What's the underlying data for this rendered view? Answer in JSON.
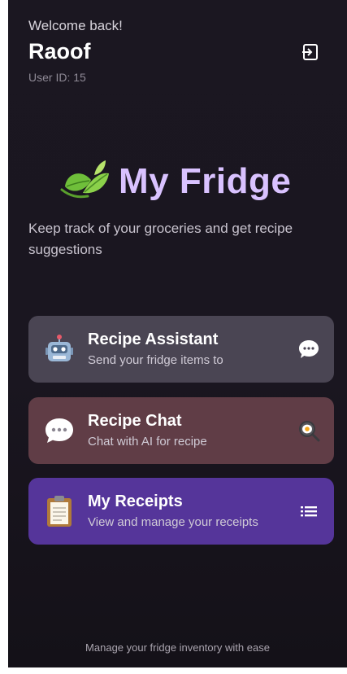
{
  "header": {
    "welcome": "Welcome back!",
    "username": "Raoof",
    "user_id": "User ID: 15",
    "logout_icon": "logout-icon"
  },
  "hero": {
    "title": "My Fridge",
    "icon": "leaf-icon",
    "tagline": "Keep track of your groceries and get recipe suggestions"
  },
  "cards": [
    {
      "title": "Recipe Assistant",
      "subtitle": "Send your fridge items to",
      "icon": "robot-icon",
      "trailing_icon": "speech-bubble-icon",
      "color": "#4a4553"
    },
    {
      "title": "Recipe Chat",
      "subtitle": "Chat with AI for recipe",
      "icon": "speech-bubble-icon",
      "trailing_icon": "frying-pan-icon",
      "color": "#603d46"
    },
    {
      "title": "My Receipts",
      "subtitle": "View and manage your receipts",
      "icon": "clipboard-icon",
      "trailing_icon": "list-icon",
      "color": "#55359a"
    }
  ],
  "footer": {
    "text": "Manage your fridge inventory with ease"
  },
  "colors": {
    "accent": "#d9c2ff",
    "background": "#1a1620"
  }
}
